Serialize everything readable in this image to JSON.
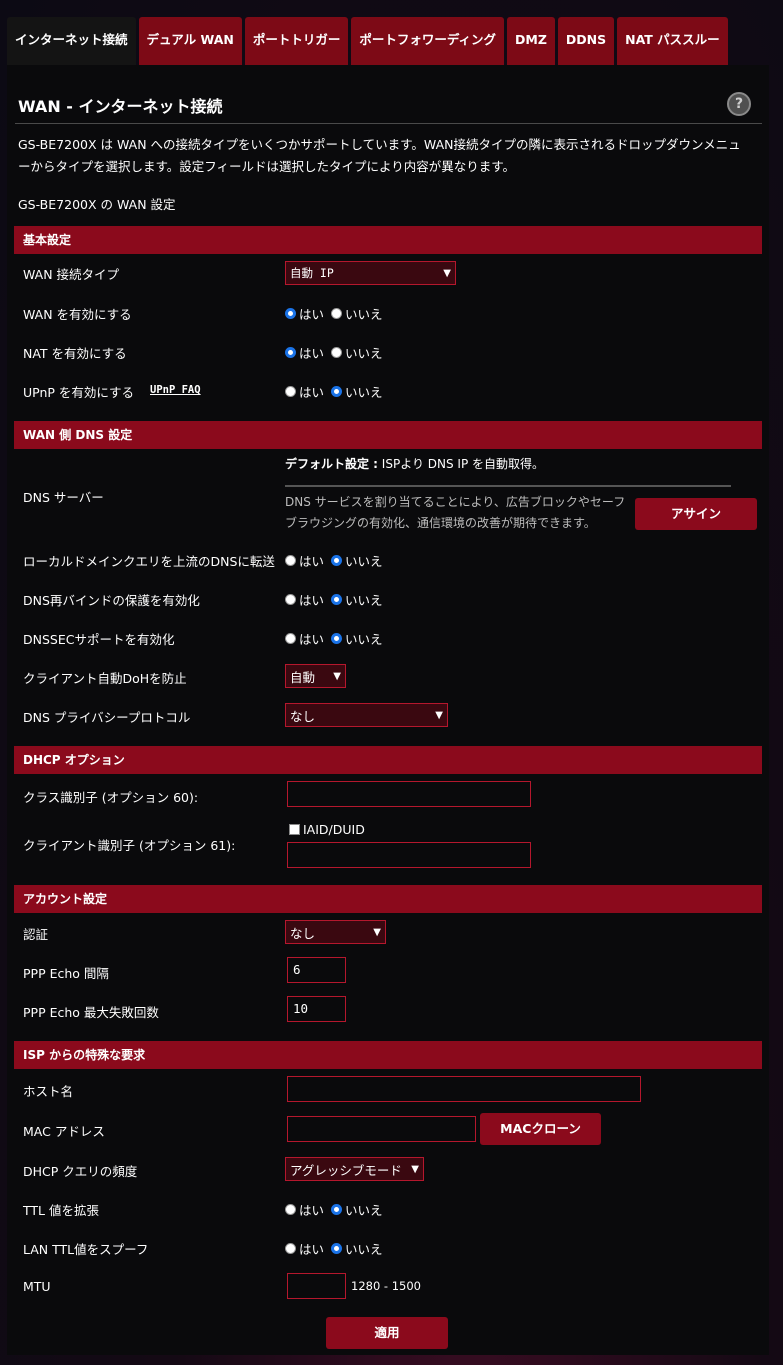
{
  "tabs": [
    "インターネット接続",
    "デュアル WAN",
    "ポートトリガー",
    "ポートフォワーディング",
    "DMZ",
    "DDNS",
    "NAT パススルー"
  ],
  "title": "WAN - インターネット接続",
  "help_icon": "?",
  "description": "GS-BE7200X は WAN への接続タイプをいくつかサポートしています。WAN接続タイプの隣に表示されるドロップダウンメニューからタイプを選択します。設定フィールドは選択したタイプにより内容が異なります。",
  "subtitle": "GS-BE7200X の WAN 設定",
  "radio_yes": "はい",
  "radio_no": "いいえ",
  "basic": {
    "header": "基本設定",
    "wan_type_label": "WAN 接続タイプ",
    "wan_type_value": "自動 IP",
    "wan_enable_label": "WAN を有効にする",
    "nat_enable_label": "NAT を有効にする",
    "upnp_label": "UPnP を有効にする",
    "upnp_faq": "UPnP FAQ"
  },
  "dns": {
    "header": "WAN 側 DNS 設定",
    "server_label": "DNS サーバー",
    "default_bold": "デフォルト設定 :",
    "default_text": " ISPより DNS IP を自動取得。",
    "note": "DNS サービスを割り当てることにより、広告ブロックやセーフブラウジングの有効化、通信環境の改善が期待できます。",
    "assign_button": "アサイン",
    "forward_label": "ローカルドメインクエリを上流のDNSに転送",
    "rebind_label": "DNS再バインドの保護を有効化",
    "dnssec_label": "DNSSECサポートを有効化",
    "doh_label": "クライアント自動DoHを防止",
    "doh_value": "自動",
    "privacy_label": "DNS プライバシープロトコル",
    "privacy_value": "なし"
  },
  "dhcp": {
    "header": "DHCP オプション",
    "class_label": "クラス識別子 (オプション 60):",
    "class_value": "",
    "client_label": "クライアント識別子 (オプション 61):",
    "iaid_label": "IAID/DUID",
    "client_value": ""
  },
  "account": {
    "header": "アカウント設定",
    "auth_label": "認証",
    "auth_value": "なし",
    "echo_interval_label": "PPP Echo 間隔",
    "echo_interval_value": "6",
    "echo_fail_label": "PPP Echo 最大失敗回数",
    "echo_fail_value": "10"
  },
  "isp": {
    "header": "ISP からの特殊な要求",
    "host_label": "ホスト名",
    "host_value": "",
    "mac_label": "MAC アドレス",
    "mac_value": "",
    "mac_clone_button": "MACクローン",
    "dhcp_freq_label": "DHCP クエリの頻度",
    "dhcp_freq_value": "アグレッシブモード",
    "ttl_label": "TTL 値を拡張",
    "lan_ttl_label": "LAN TTL値をスプーフ",
    "mtu_label": "MTU",
    "mtu_value": "",
    "mtu_range": "1280 - 1500"
  },
  "apply_button": "適用",
  "colors": {
    "accent": "#8b0a1c",
    "border": "#b5172d",
    "radio_on": "#1a73e8"
  }
}
